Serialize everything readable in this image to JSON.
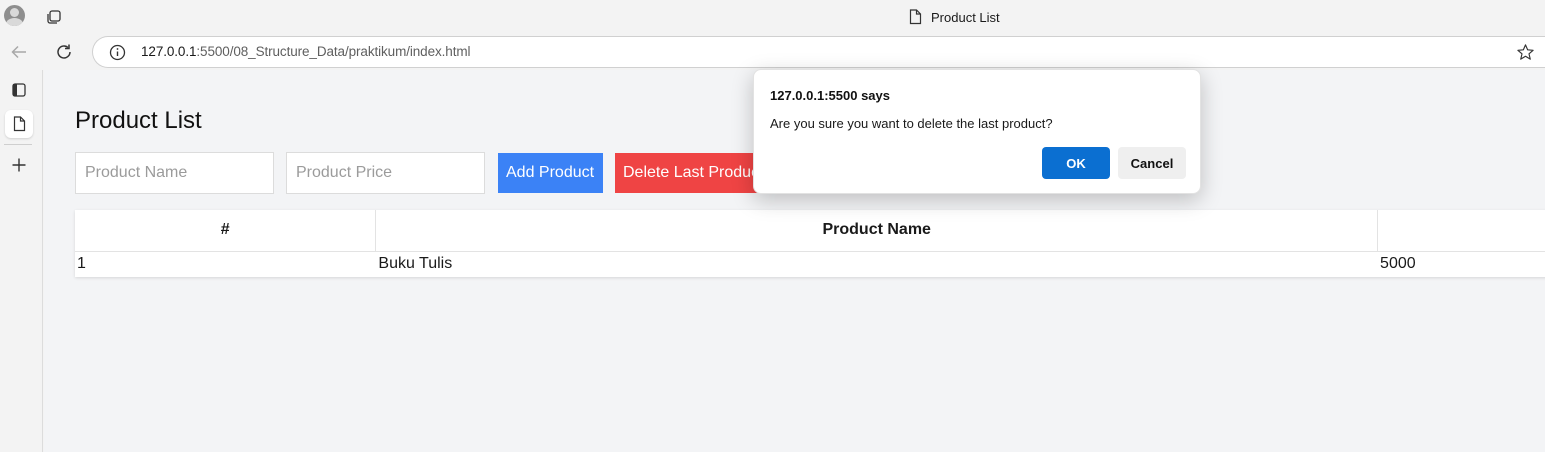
{
  "browser": {
    "tab_title": "Product List",
    "url_host": "127.0.0.1",
    "url_rest": ":5500/08_Structure_Data/praktikum/index.html"
  },
  "page": {
    "title": "Product List",
    "inputs": {
      "name_placeholder": "Product Name",
      "name_value": "",
      "price_placeholder": "Product Price",
      "price_value": ""
    },
    "buttons": {
      "add": "Add Product",
      "delete": "Delete Last Product"
    },
    "table": {
      "headers": [
        "#",
        "Product Name",
        ""
      ],
      "rows": [
        [
          "1",
          "Buku Tulis",
          "5000"
        ]
      ]
    }
  },
  "dialog": {
    "title": "127.0.0.1:5500 says",
    "message": "Are you sure you want to delete the last product?",
    "ok_label": "OK",
    "cancel_label": "Cancel"
  },
  "colors": {
    "add_button": "#3b82f6",
    "delete_button": "#ef4444",
    "dialog_ok": "#0b6fd1"
  },
  "icons": [
    "profile-avatar-icon",
    "tab-actions-icon",
    "page-icon",
    "back-arrow-icon",
    "refresh-icon",
    "info-icon",
    "star-icon",
    "vertical-tabs-icon",
    "plus-icon"
  ]
}
